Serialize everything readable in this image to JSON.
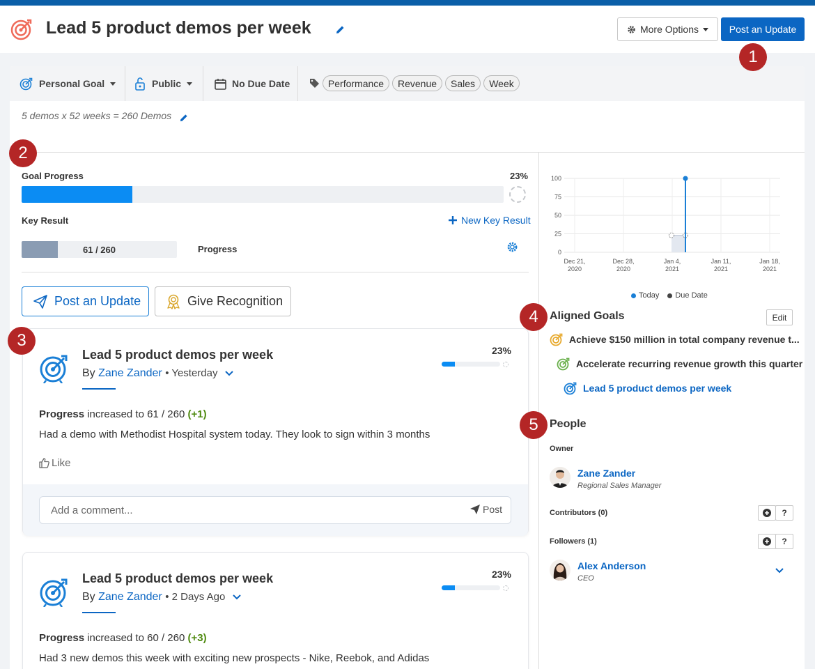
{
  "header": {
    "title": "Lead 5 product demos per week",
    "more_options_label": "More Options",
    "post_update_label": "Post an Update"
  },
  "callouts": [
    "1",
    "2",
    "3",
    "4",
    "5"
  ],
  "meta": {
    "goal_type": "Personal Goal",
    "visibility": "Public",
    "due_date": "No Due Date",
    "tags": [
      "Performance",
      "Revenue",
      "Sales",
      "Week"
    ]
  },
  "description": "5 demos x 52 weeks = 260 Demos",
  "progress": {
    "label": "Goal Progress",
    "percent_text": "23%",
    "percent": 23,
    "key_result_label": "Key Result",
    "new_key_result_label": "New Key Result",
    "key_result_value": "61 / 260",
    "key_result_current": 61,
    "key_result_target": 260,
    "key_result_name": "Progress"
  },
  "actions": {
    "post_update_label": "Post an Update",
    "give_recognition_label": "Give Recognition"
  },
  "feed": [
    {
      "title": "Lead 5 product demos per week",
      "by_prefix": "By",
      "author": "Zane Zander",
      "time": "• Yesterday",
      "percent_text": "23%",
      "percent": 23,
      "progress_label": "Progress",
      "progress_text": "increased to 61 / 260",
      "delta": "(+1)",
      "note": "Had a demo with Methodist Hospital system today. They look to sign within 3 months",
      "like_label": "Like",
      "comment_placeholder": "Add a comment...",
      "post_label": "Post"
    },
    {
      "title": "Lead 5 product demos per week",
      "by_prefix": "By",
      "author": "Zane Zander",
      "time": "• 2 Days Ago",
      "percent_text": "23%",
      "percent": 23,
      "progress_label": "Progress",
      "progress_text": "increased to 60 / 260",
      "delta": "(+3)",
      "note": "Had 3 new demos this week with exciting new prospects - Nike, Reebok, and Adidas"
    }
  ],
  "chart_data": {
    "type": "line",
    "y_ticks": [
      "100",
      "75",
      "50",
      "25",
      "0"
    ],
    "x_ticks": [
      [
        "Dec 21,",
        "2020"
      ],
      [
        "Dec 28,",
        "2020"
      ],
      [
        "Jan 4,",
        "2021"
      ],
      [
        "Jan 11,",
        "2021"
      ],
      [
        "Jan 18,",
        "2021"
      ]
    ],
    "ylim": [
      0,
      100
    ],
    "today_value": 100,
    "progress_value": 23,
    "legend": [
      {
        "name": "Today",
        "color": "#1a7fd6"
      },
      {
        "name": "Due Date",
        "color": "#444444"
      }
    ]
  },
  "aligned": {
    "heading": "Aligned Goals",
    "edit_label": "Edit",
    "items": [
      {
        "label": "Achieve $150 million in total company revenue t...",
        "color": "#333333",
        "icon_color": "#e7a92d"
      },
      {
        "label": "Accelerate recurring revenue growth this quarter",
        "color": "#333333",
        "icon_color": "#6ab04c"
      },
      {
        "label": "Lead 5 product demos per week",
        "color": "#0b66c3",
        "icon_color": "#1a7fd6"
      }
    ]
  },
  "people": {
    "heading": "People",
    "owner_label": "Owner",
    "owner_name": "Zane Zander",
    "owner_role": "Regional Sales Manager",
    "contributors_label": "Contributors (0)",
    "followers_label": "Followers (1)",
    "follower_name": "Alex Anderson",
    "follower_role": "CEO"
  }
}
